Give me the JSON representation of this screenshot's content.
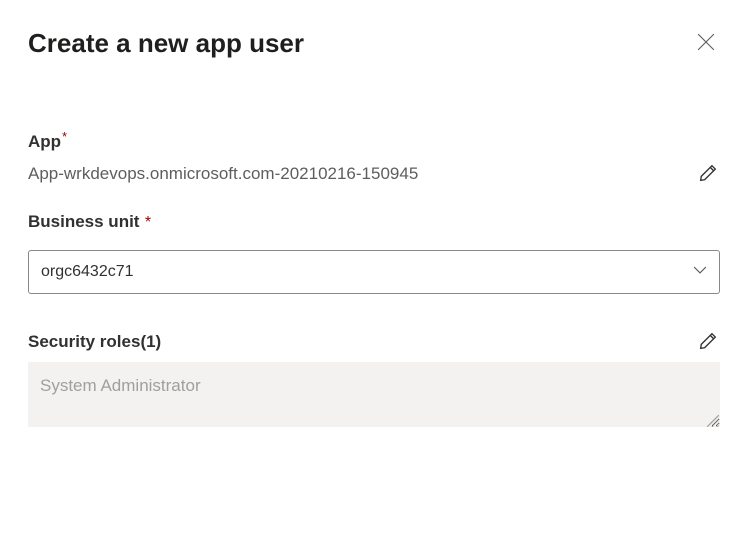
{
  "header": {
    "title": "Create a new app user"
  },
  "app": {
    "label": "App",
    "value": "App-wrkdevops.onmicrosoft.com-20210216-150945"
  },
  "businessUnit": {
    "label": "Business unit",
    "selected": "orgc6432c71"
  },
  "securityRoles": {
    "label": "Security roles(1)",
    "items": [
      "System Administrator"
    ]
  }
}
